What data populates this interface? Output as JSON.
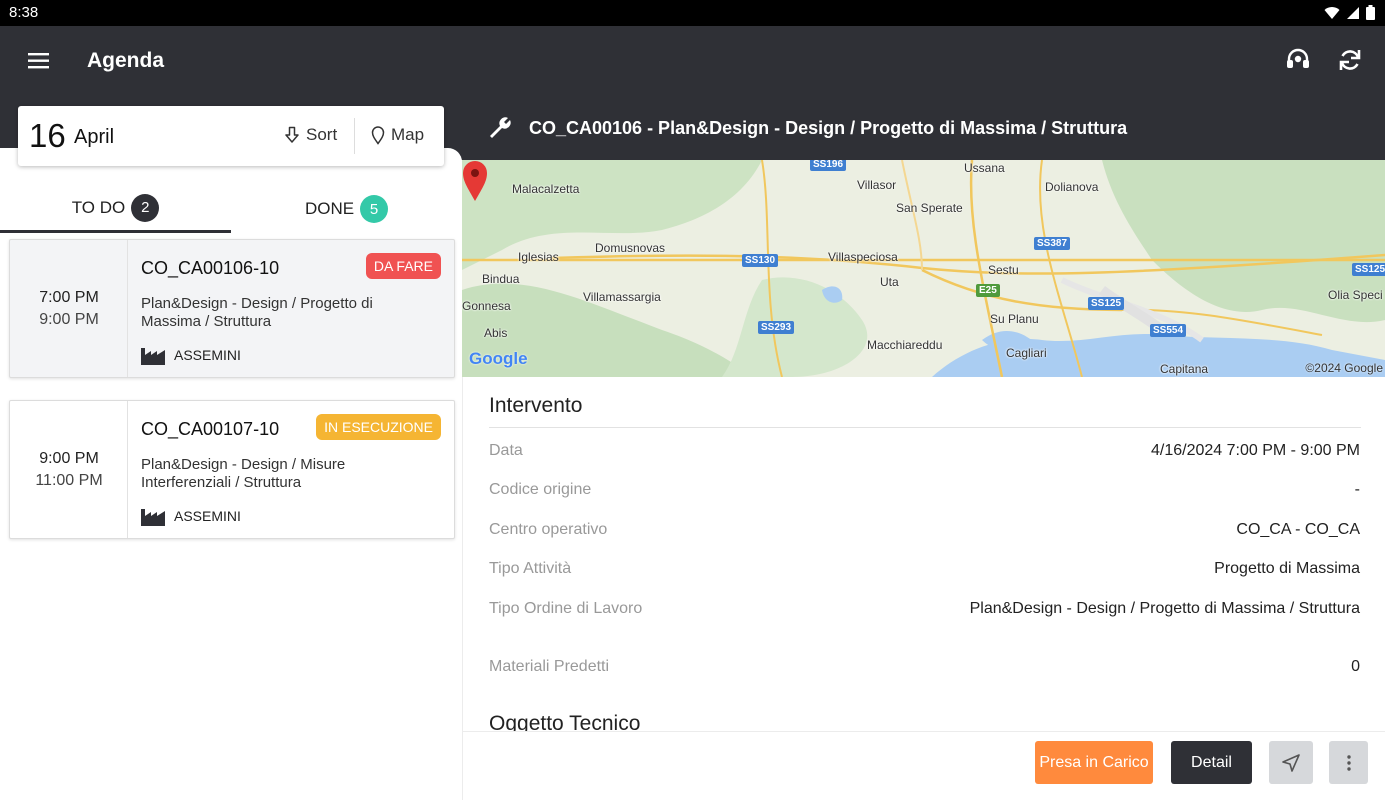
{
  "status_bar": {
    "time": "8:38"
  },
  "app_bar": {
    "title": "Agenda"
  },
  "date_card": {
    "day": "16",
    "month": "April",
    "sort_label": "Sort",
    "map_label": "Map"
  },
  "tabs": {
    "todo": {
      "label": "TO DO",
      "count": "2"
    },
    "done": {
      "label": "DONE",
      "count": "5"
    }
  },
  "tasks": [
    {
      "start": "7:00 PM",
      "end": "9:00 PM",
      "code": "CO_CA00106-10",
      "status": "DA FARE",
      "status_color": "#f05252",
      "description": "Plan&Design - Design / Progetto di Massima / Struttura",
      "location": "ASSEMINI"
    },
    {
      "start": "9:00 PM",
      "end": "11:00 PM",
      "code": "CO_CA00107-10",
      "status": "IN ESECUZIONE",
      "status_color": "#f5b533",
      "description": "Plan&Design - Design / Misure Interferenziali / Struttura",
      "location": "ASSEMINI"
    }
  ],
  "detail": {
    "header_title": "CO_CA00106 - Plan&Design - Design / Progetto di Massima / Struttura",
    "map": {
      "labels": {
        "ussana": "Ussana",
        "malacalzetta": "Malacalzetta",
        "villasor": "Villasor",
        "dolianova": "Dolianova",
        "san_sperate": "San Sperate",
        "domusnovas": "Domusnovas",
        "iglesias": "Iglesias",
        "villaspeciosa": "Villaspeciosa",
        "sestu": "Sestu",
        "bindua": "Bindua",
        "uta": "Uta",
        "villamassargia": "Villamassargia",
        "gonnesa": "Gonnesa",
        "su_planu": "Su Planu",
        "olia_speci": "Olia Speci",
        "abis": "Abis",
        "macchiareddu": "Macchiareddu",
        "cagliari": "Cagliari",
        "capitana": "Capitana"
      },
      "roads": {
        "ss196": "SS196",
        "ss387": "SS387",
        "ss130": "SS130",
        "ss125": "SS125",
        "ss125_right": "SS125",
        "ss293": "SS293",
        "ss554": "SS554",
        "e25": "E25"
      },
      "logo": "Google",
      "copyright": "©2024 Google"
    },
    "intervento_title": "Intervento",
    "rows": [
      {
        "label": "Data",
        "value": "4/16/2024 7:00 PM - 9:00 PM"
      },
      {
        "label": "Codice origine",
        "value": "-"
      },
      {
        "label": "Centro operativo",
        "value": "CO_CA - CO_CA"
      },
      {
        "label": "Tipo Attività",
        "value": "Progetto di Massima"
      },
      {
        "label": "Tipo Ordine di Lavoro",
        "value": "Plan&Design - Design / Progetto di Massima / Struttura"
      },
      {
        "label": "Materiali Predetti",
        "value": "0"
      }
    ],
    "oggetto_title": "Oggetto Tecnico"
  },
  "footer": {
    "take_charge_label": "Presa in Carico",
    "detail_label": "Detail",
    "accent_color": "#ff8a3d"
  },
  "icons": {
    "menu": "menu-icon",
    "support": "headset-icon",
    "refresh": "refresh-icon",
    "sort": "sort-down-icon",
    "map": "map-pin-icon",
    "wrench": "wrench-icon",
    "factory": "factory-icon",
    "navigate": "navigation-icon",
    "more": "more-vertical-icon"
  }
}
